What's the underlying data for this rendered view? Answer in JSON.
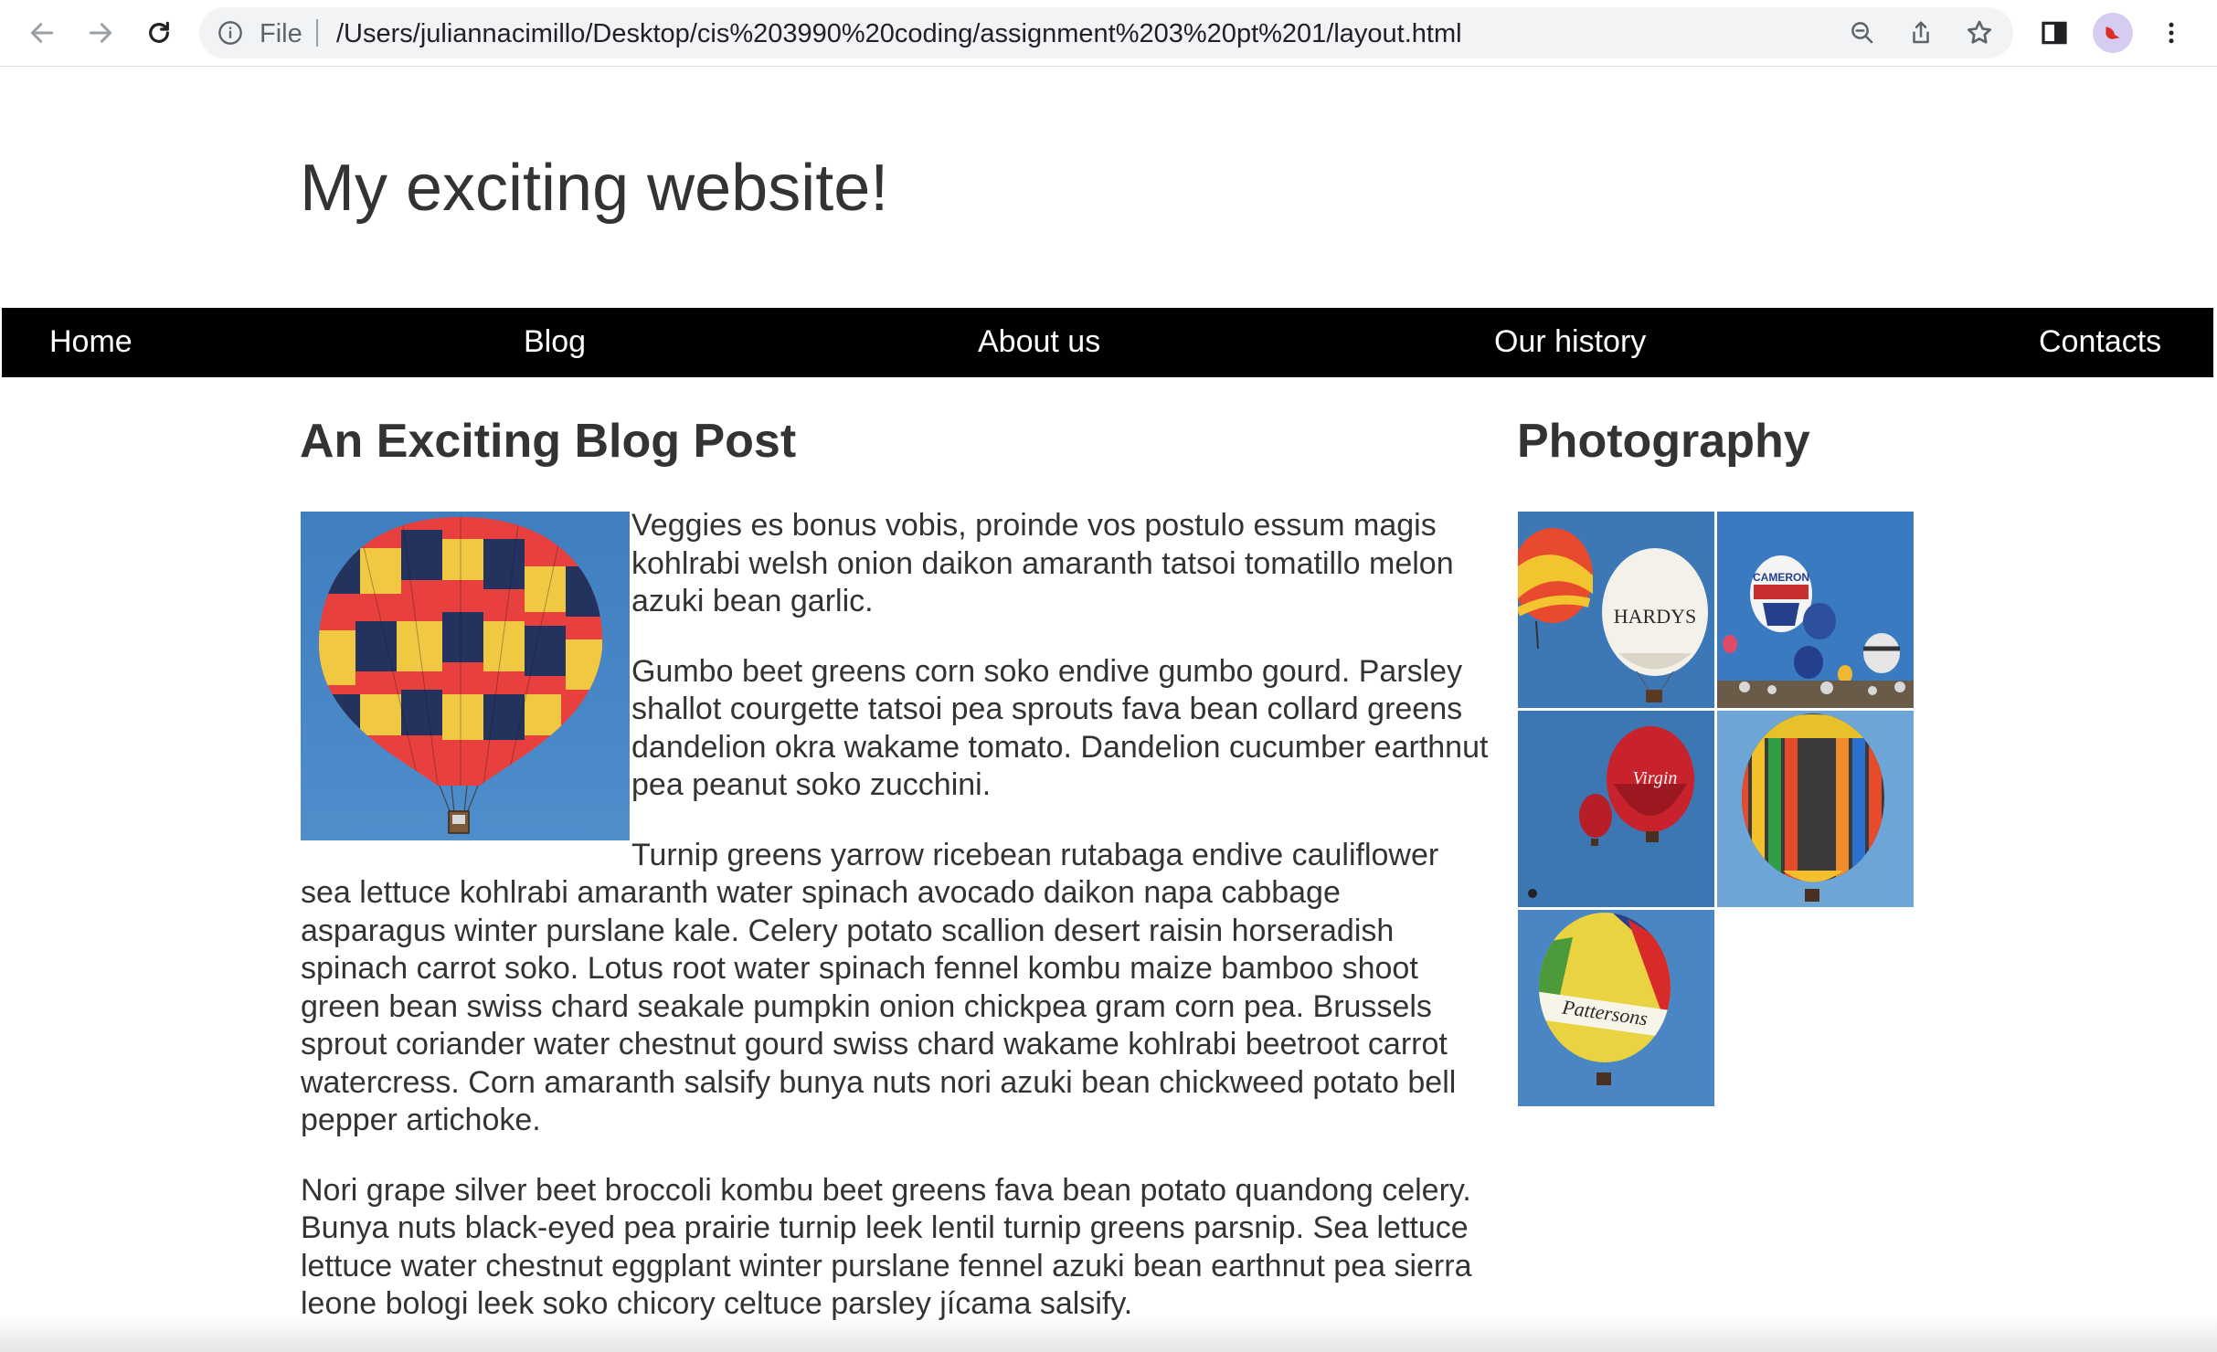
{
  "browser": {
    "scheme_label": "File",
    "url": "/Users/juliannacimillo/Desktop/cis%203990%20coding/assignment%203%20pt%201/layout.html",
    "icons": [
      "back-arrow-icon",
      "forward-arrow-icon",
      "reload-icon",
      "info-icon",
      "zoom-icon",
      "share-icon",
      "bookmark-star-icon",
      "side-panel-icon",
      "profile-avatar",
      "more-menu-icon"
    ]
  },
  "site": {
    "title": "My exciting website!",
    "nav": [
      "Home",
      "Blog",
      "About us",
      "Our history",
      "Contacts"
    ]
  },
  "post": {
    "title": "An Exciting Blog Post",
    "image": "hot-air-balloon-photo",
    "paragraphs": [
      "Veggies es bonus vobis, proinde vos postulo essum magis kohlrabi welsh onion daikon amaranth tatsoi tomatillo melon azuki bean garlic.",
      "Gumbo beet greens corn soko endive gumbo gourd. Parsley shallot courgette tatsoi pea sprouts fava bean collard greens dandelion okra wakame tomato. Dandelion cucumber earthnut pea peanut soko zucchini.",
      "Turnip greens yarrow ricebean rutabaga endive cauliflower sea lettuce kohlrabi amaranth water spinach avocado daikon napa cabbage asparagus winter purslane kale. Celery potato scallion desert raisin horseradish spinach carrot soko. Lotus root water spinach fennel kombu maize bamboo shoot green bean swiss chard seakale pumpkin onion chickpea gram corn pea. Brussels sprout coriander water chestnut gourd swiss chard wakame kohlrabi beetroot carrot watercress. Corn amaranth salsify bunya nuts nori azuki bean chickweed potato bell pepper artichoke.",
      "Nori grape silver beet broccoli kombu beet greens fava bean potato quandong celery. Bunya nuts black-eyed pea prairie turnip leek lentil turnip greens parsnip. Sea lettuce lettuce water chestnut eggplant winter purslane fennel azuki bean earthnut pea sierra leone bologi leek soko chicory celtuce parsley jícama salsify."
    ]
  },
  "sidebar": {
    "title": "Photography",
    "thumbs": [
      {
        "name": "thumb-balloons-hardys",
        "text": "HARDYS"
      },
      {
        "name": "thumb-balloons-festival",
        "text": "CAMERON"
      },
      {
        "name": "thumb-balloons-red-virgin",
        "text": "Virgin"
      },
      {
        "name": "thumb-balloon-striped",
        "text": ""
      },
      {
        "name": "thumb-balloon-pattersons",
        "text": "Pattersons"
      }
    ]
  },
  "colors": {
    "nav_bg": "#000000",
    "nav_text": "#ffffff",
    "sky": "#4a86c0",
    "text": "#333333"
  }
}
